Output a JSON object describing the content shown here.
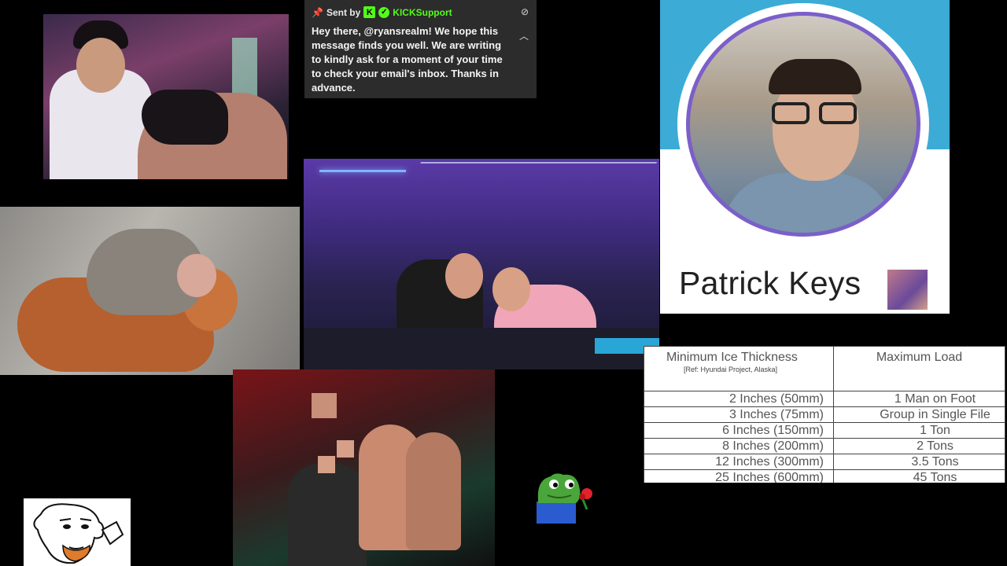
{
  "chat": {
    "pin_icon": "pin-icon",
    "sent_by_label": "Sent by",
    "sender_name": "KICKSupport",
    "brand_letter": "K",
    "verified_icon": "verified-icon",
    "hide_icon": "eye-off-icon",
    "collapse_icon": "chevron-up-icon",
    "message": "Hey there, @ryansrealm! We hope this message finds you well. We are writing to kindly ask for a moment of your time to check your email's inbox. Thanks in advance."
  },
  "profile": {
    "name": "Patrick Keys"
  },
  "ice_table": {
    "header_left": "Minimum Ice Thickness",
    "header_left_note": "[Ref: Hyundai Project, Alaska]",
    "header_right": "Maximum Load",
    "rows": [
      {
        "thickness": "2 Inches (50mm)",
        "load": "1 Man on Foot"
      },
      {
        "thickness": "3 Inches (75mm)",
        "load": "Group in Single File"
      },
      {
        "thickness": "6 Inches (150mm)",
        "load": "1 Ton"
      },
      {
        "thickness": "8 Inches (200mm)",
        "load": "2 Tons"
      },
      {
        "thickness": "12 Inches (300mm)",
        "load": "3.5 Tons"
      },
      {
        "thickness": "25 Inches (600mm)",
        "load": "45 Tons"
      }
    ]
  },
  "colors": {
    "kick_green": "#53fc18",
    "chat_bg": "#2c2c2c",
    "profile_blue": "#3cabd6",
    "profile_ring": "#7b5fc9"
  }
}
